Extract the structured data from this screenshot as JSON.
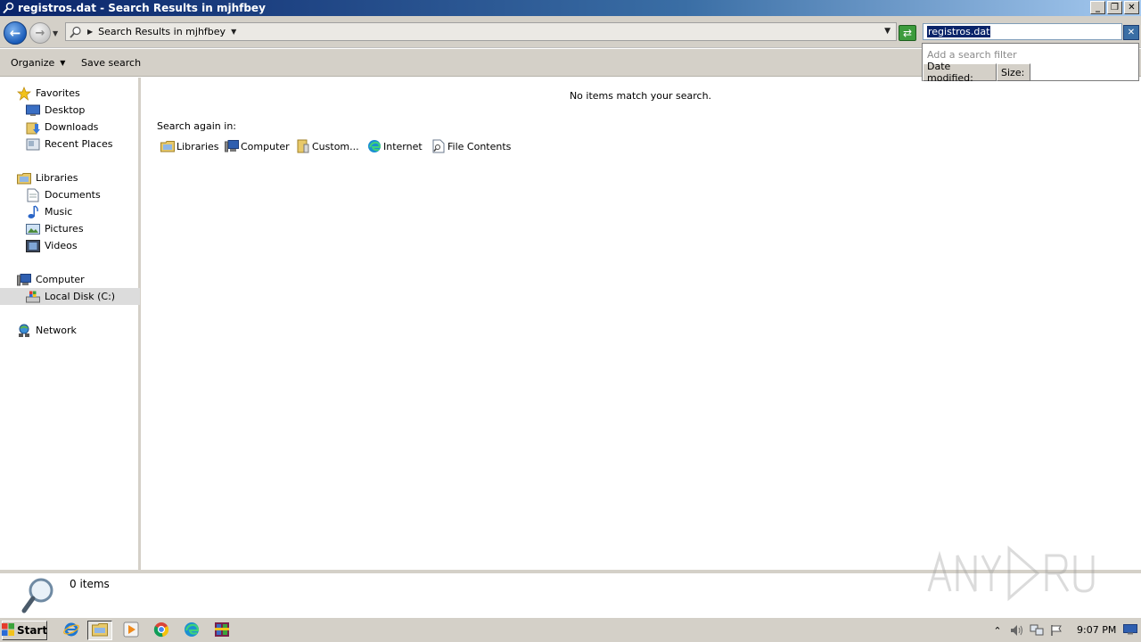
{
  "window": {
    "title": "registros.dat - Search Results in mjhfbey",
    "buttons": {
      "minimize": "_",
      "restore": "❐",
      "close": "✕"
    }
  },
  "address_bar": {
    "path": "Search Results in mjhfbey"
  },
  "search": {
    "query": "registros.dat",
    "filter_hint": "Add a search filter",
    "filters": [
      "Date modified:",
      "Size:"
    ]
  },
  "toolbar": {
    "organize": "Organize",
    "save_search": "Save search"
  },
  "sidebar": {
    "favorites": {
      "label": "Favorites",
      "items": [
        "Desktop",
        "Downloads",
        "Recent Places"
      ]
    },
    "libraries": {
      "label": "Libraries",
      "items": [
        "Documents",
        "Music",
        "Pictures",
        "Videos"
      ]
    },
    "computer": {
      "label": "Computer",
      "items": [
        "Local Disk (C:)"
      ]
    },
    "network": {
      "label": "Network"
    },
    "selected": "Local Disk (C:)"
  },
  "content": {
    "empty_message": "No items match your search.",
    "search_again_label": "Search again in:",
    "locations": [
      "Libraries",
      "Computer",
      "Custom...",
      "Internet",
      "File Contents"
    ]
  },
  "details": {
    "count": "0 items"
  },
  "taskbar": {
    "start": "Start",
    "clock": "9:07 PM"
  },
  "colors": {
    "title_bar_start": "#0a246a",
    "chrome": "#d4d0c8",
    "selection": "#0a246a"
  }
}
